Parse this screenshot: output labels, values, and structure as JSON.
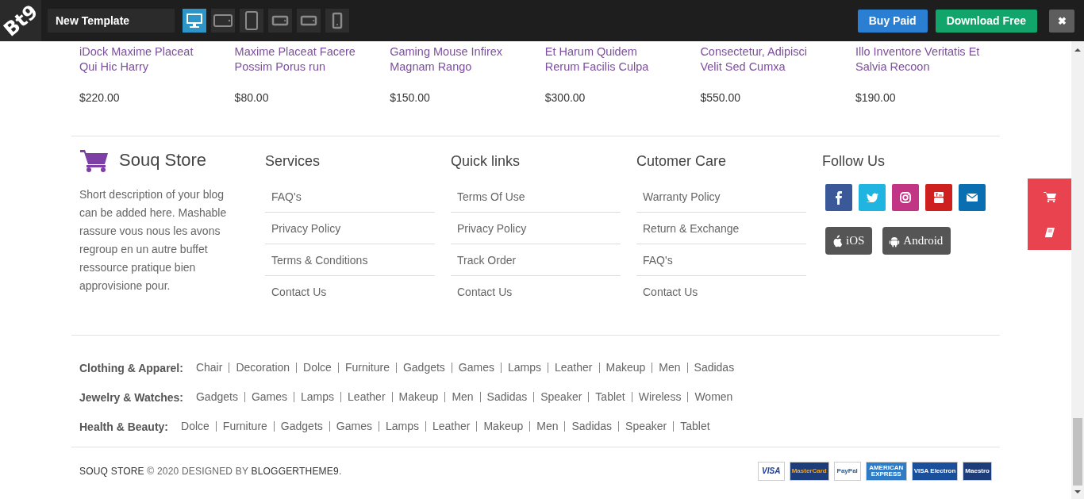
{
  "toolbar": {
    "logo": "Bt9",
    "template_name": "New Template",
    "devices": [
      {
        "kind": "desktop",
        "selected": true
      },
      {
        "kind": "tablet-landscape",
        "selected": false
      },
      {
        "kind": "tablet-portrait",
        "selected": false
      },
      {
        "kind": "phone-landscape",
        "selected": false
      },
      {
        "kind": "phone-landscape",
        "selected": false
      },
      {
        "kind": "phone-portrait",
        "selected": false
      }
    ],
    "buttons": [
      {
        "kind": "buy",
        "label": "Buy Paid"
      },
      {
        "kind": "download",
        "label": "Download Free"
      },
      {
        "kind": "close",
        "label": "✖"
      }
    ]
  },
  "products": [
    {
      "title": "iDock Maxime Placeat\nQui Hic Harry",
      "price": "$220.00"
    },
    {
      "title": "Maxime Placeat Facere\nPossim Porus run",
      "price": "$80.00"
    },
    {
      "title": "Gaming Mouse Infirex\nMagnam Rango",
      "price": "$150.00"
    },
    {
      "title": "Et Harum Quidem\nRerum Facilis Culpa",
      "price": "$300.00"
    },
    {
      "title": "Consectetur, Adipisci\nVelit Sed Cumxa",
      "price": "$550.00"
    },
    {
      "title": "Illo Inventore Veritatis Et\nSalvia Recoon",
      "price": "$190.00"
    }
  ],
  "about": {
    "brand": "Souq Store",
    "description": "Short description of your blog can be added here. Mashable rassure vous nous les avons regroup en un autre buffet ressource pratique bien approvisione pour."
  },
  "link_columns": [
    {
      "heading": "Services",
      "links": [
        "FAQ's",
        "Privacy Policy",
        "Terms & Conditions",
        "Contact Us"
      ]
    },
    {
      "heading": "Quick links",
      "links": [
        "Terms Of Use",
        "Privacy Policy",
        "Track Order",
        "Contact Us"
      ]
    },
    {
      "heading": "Cutomer Care",
      "links": [
        "Warranty Policy",
        "Return & Exchange",
        "FAQ's",
        "Contact Us"
      ]
    }
  ],
  "follow": {
    "heading": "Follow Us",
    "social": [
      {
        "kind": "facebook",
        "color": "#3b5998"
      },
      {
        "kind": "twitter",
        "color": "#1fb5e0"
      },
      {
        "kind": "instagram",
        "color": "#c13584"
      },
      {
        "kind": "youtube",
        "color": "#cd201f"
      },
      {
        "kind": "email",
        "color": "#0a6fb0"
      }
    ],
    "apps": [
      {
        "kind": "ios",
        "label": "iOS"
      },
      {
        "kind": "android",
        "label": "Android"
      }
    ]
  },
  "tag_groups": [
    {
      "label": "Clothing & Apparel:",
      "tags": [
        "Chair",
        "Decoration",
        "Dolce",
        "Furniture",
        "Gadgets",
        "Games",
        "Lamps",
        "Leather",
        "Makeup",
        "Men",
        "Sadidas"
      ]
    },
    {
      "label": "Jewelry & Watches:",
      "tags": [
        "Gadgets",
        "Games",
        "Lamps",
        "Leather",
        "Makeup",
        "Men",
        "Sadidas",
        "Speaker",
        "Tablet",
        "Wireless",
        "Women"
      ]
    },
    {
      "label": "Health & Beauty:",
      "tags": [
        "Dolce",
        "Furniture",
        "Gadgets",
        "Games",
        "Lamps",
        "Leather",
        "Makeup",
        "Men",
        "Sadidas",
        "Speaker",
        "Tablet"
      ]
    }
  ],
  "copyright": {
    "brand": "SOUQ STORE",
    "text": "© 2020 DESIGNED BY",
    "author": "BLOGGERTHEME9",
    "end": "."
  },
  "payments": [
    {
      "kind": "visa",
      "label": "VISA"
    },
    {
      "kind": "mastercard",
      "label": "MasterCard"
    },
    {
      "kind": "paypal",
      "label": "PayPal"
    },
    {
      "kind": "amex",
      "label": "AMERICAN EXPRESS"
    },
    {
      "kind": "visa-electron",
      "label": "VISA Electron"
    },
    {
      "kind": "maestro",
      "label": "Maestro"
    }
  ]
}
